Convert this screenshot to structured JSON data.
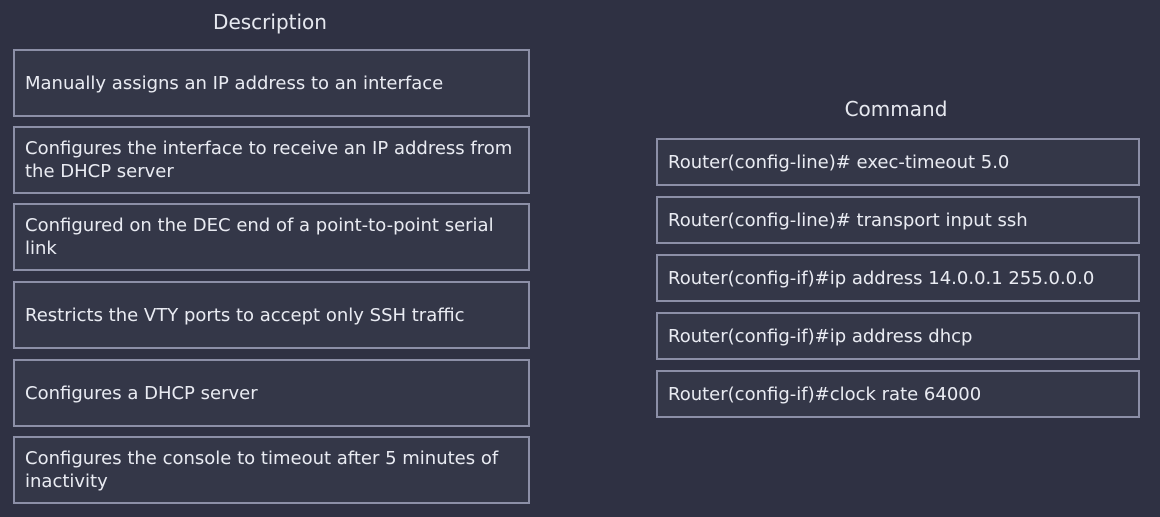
{
  "description_panel": {
    "heading": "Description",
    "items": [
      {
        "text": "Manually assigns an IP address to an interface"
      },
      {
        "text": "Configures the interface to receive an IP address from the DHCP server"
      },
      {
        "text": "Configured on the DEC end of a point-to-point serial link"
      },
      {
        "text": "Restricts the VTY ports to accept only SSH traffic"
      },
      {
        "text": "Configures a DHCP server"
      },
      {
        "text": "Configures the console to timeout after 5 minutes of inactivity"
      }
    ]
  },
  "command_panel": {
    "heading": "Command",
    "items": [
      {
        "text": "Router(config-line)# exec-timeout 5.0"
      },
      {
        "text": "Router(config-line)# transport input ssh"
      },
      {
        "text": "Router(config-if)#ip address 14.0.0.1 255.0.0.0"
      },
      {
        "text": "Router(config-if)#ip address dhcp"
      },
      {
        "text": "Router(config-if)#clock rate 64000"
      }
    ]
  },
  "colors": {
    "background": "#2f3143",
    "box_border": "#8c8fa7",
    "box_fill": "#343748",
    "text": "#e9ebf2"
  }
}
